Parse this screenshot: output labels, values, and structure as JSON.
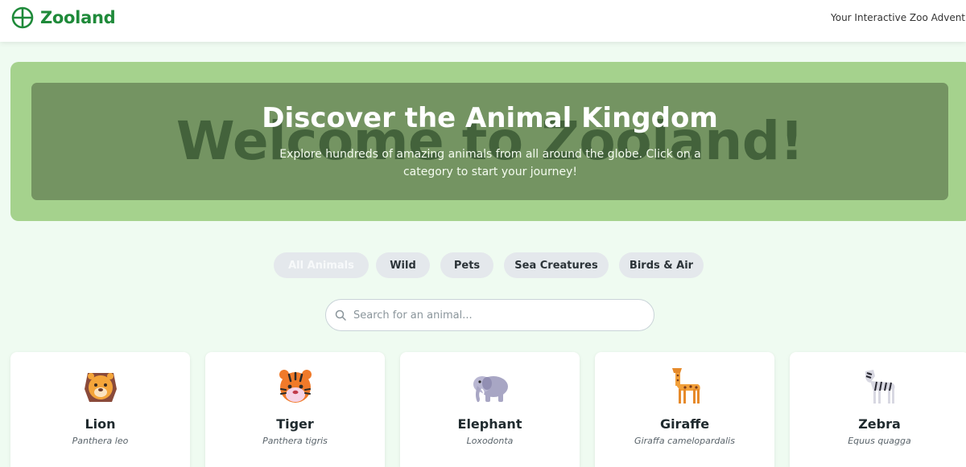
{
  "header": {
    "brand": "Zooland",
    "tagline": "Your Interactive Zoo Adventure"
  },
  "hero": {
    "watermark": "Welcome to Zooland!",
    "title": "Discover the Animal Kingdom",
    "subtitle": "Explore hundreds of amazing animals from all around the globe. Click on a category to start your journey!"
  },
  "filters": [
    {
      "label": "All Animals",
      "active": true
    },
    {
      "label": "Wild",
      "active": false
    },
    {
      "label": "Pets",
      "active": false
    },
    {
      "label": "Sea Creatures",
      "active": false
    },
    {
      "label": "Birds & Air",
      "active": false
    }
  ],
  "search": {
    "placeholder": "Search for an animal...",
    "value": ""
  },
  "animals": [
    {
      "name": "Lion",
      "scientific": "Panthera leo",
      "icon": "lion-icon"
    },
    {
      "name": "Tiger",
      "scientific": "Panthera tigris",
      "icon": "tiger-icon"
    },
    {
      "name": "Elephant",
      "scientific": "Loxodonta",
      "icon": "elephant-icon"
    },
    {
      "name": "Giraffe",
      "scientific": "Giraffa camelopardalis",
      "icon": "giraffe-icon"
    },
    {
      "name": "Zebra",
      "scientific": "Equus quagga",
      "icon": "zebra-icon"
    }
  ],
  "colors": {
    "brand": "#1f8a3a",
    "hero_outer": "#a5d28d",
    "hero_inner": "#749462",
    "page_bg": "#effbf1"
  }
}
